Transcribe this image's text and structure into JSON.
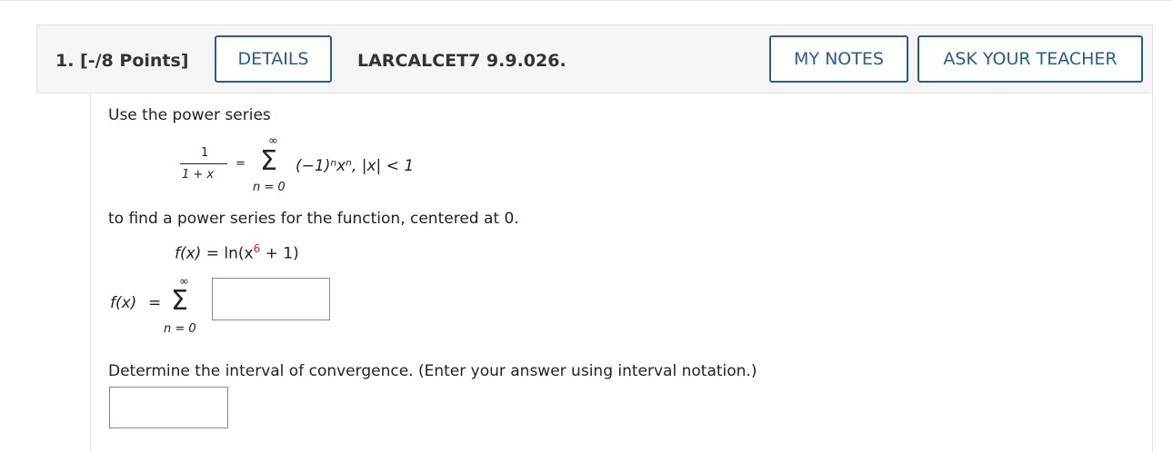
{
  "header": {
    "question_number": "1. [-/8 Points]",
    "details_button": "DETAILS",
    "question_code": "LARCALCET7 9.9.026.",
    "my_notes_button": "MY NOTES",
    "ask_teacher_button": "ASK YOUR TEACHER"
  },
  "problem": {
    "intro": "Use the power series",
    "series": {
      "numerator": "1",
      "denominator": "1 + x",
      "equals": "=",
      "upper_limit": "∞",
      "sigma": "Σ",
      "lower_limit": "n = 0",
      "term": "(−1)ⁿxⁿ, |x| < 1"
    },
    "instruction": "to find a power series for the function, centered at 0.",
    "function": {
      "lhs": "f(x)",
      "rhs_prefix": "= ln(x",
      "exponent": "6",
      "rhs_suffix": "+ 1)"
    },
    "answer_series": {
      "lhs": "f(x)",
      "equals": "=",
      "upper_limit": "∞",
      "sigma": "Σ",
      "lower_limit": "n = 0"
    },
    "interval_prompt": "Determine the interval of convergence. (Enter your answer using interval notation.)"
  },
  "answers": {
    "series_term": "",
    "interval": ""
  }
}
